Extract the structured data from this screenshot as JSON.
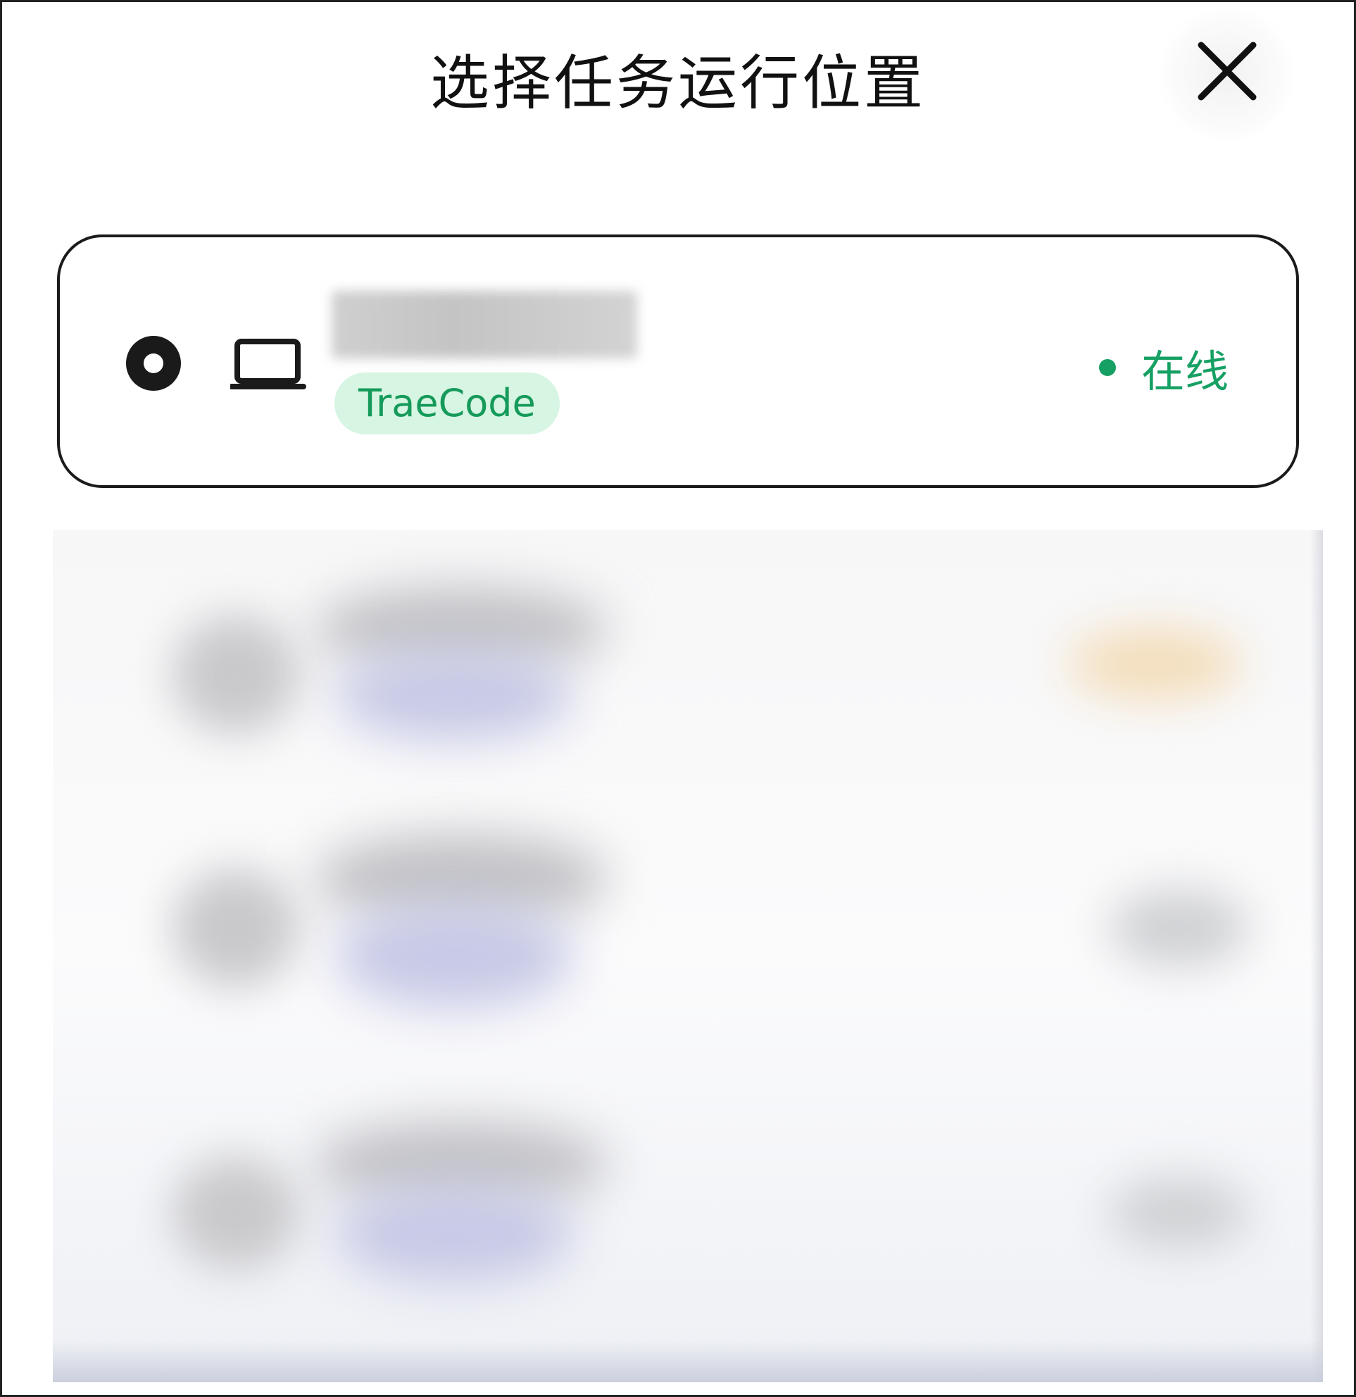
{
  "header": {
    "title": "选择任务运行位置",
    "close_icon": "close-icon"
  },
  "selected_location": {
    "radio_icon": "radio-selected-icon",
    "device_icon": "laptop-icon",
    "tag": "TraeCode",
    "status": "在线",
    "status_color": "#16a064",
    "tag_bg": "#d7f5e3"
  },
  "other_locations": {
    "count": 3,
    "note_blurred": true
  }
}
